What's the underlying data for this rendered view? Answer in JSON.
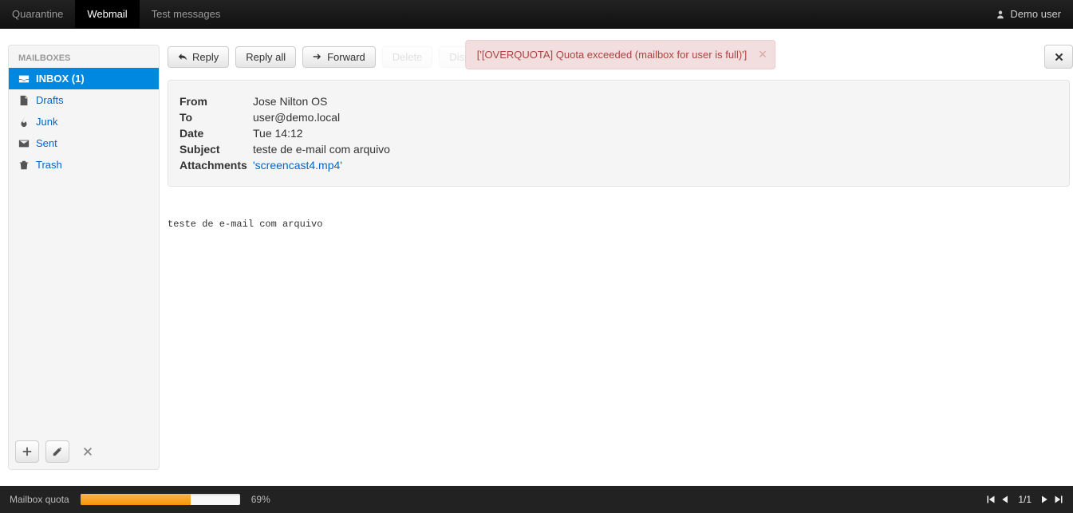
{
  "nav": {
    "items": [
      {
        "label": "Quarantine",
        "active": false
      },
      {
        "label": "Webmail",
        "active": true
      },
      {
        "label": "Test messages",
        "active": false
      }
    ],
    "user_label": "Demo user"
  },
  "alert": {
    "text": "['[OVERQUOTA] Quota exceeded (mailbox for user is full)']"
  },
  "sidebar": {
    "title": "MAILBOXES",
    "items": [
      {
        "label": "INBOX (1)",
        "icon": "inbox-icon",
        "active": true
      },
      {
        "label": "Drafts",
        "icon": "file-icon",
        "active": false
      },
      {
        "label": "Junk",
        "icon": "fire-icon",
        "active": false
      },
      {
        "label": "Sent",
        "icon": "envelope-icon",
        "active": false
      },
      {
        "label": "Trash",
        "icon": "trash-icon",
        "active": false
      }
    ]
  },
  "toolbar": {
    "reply": "Reply",
    "reply_all": "Reply all",
    "forward": "Forward",
    "delete": "Delete",
    "display": "Display options"
  },
  "message": {
    "headers": {
      "from_label": "From",
      "from": "Jose Nilton OS",
      "to_label": "To",
      "to": "user@demo.local",
      "date_label": "Date",
      "date": "Tue 14:12",
      "subject_label": "Subject",
      "subject": "teste de e-mail com arquivo",
      "attachments_label": "Attachments",
      "attachment_name": "'screencast4.mp4'"
    },
    "body": "teste de e-mail com arquivo"
  },
  "footer": {
    "quota_label": "Mailbox quota",
    "quota_percent": 69,
    "quota_percent_text": "69%",
    "pager_text": "1/1"
  }
}
